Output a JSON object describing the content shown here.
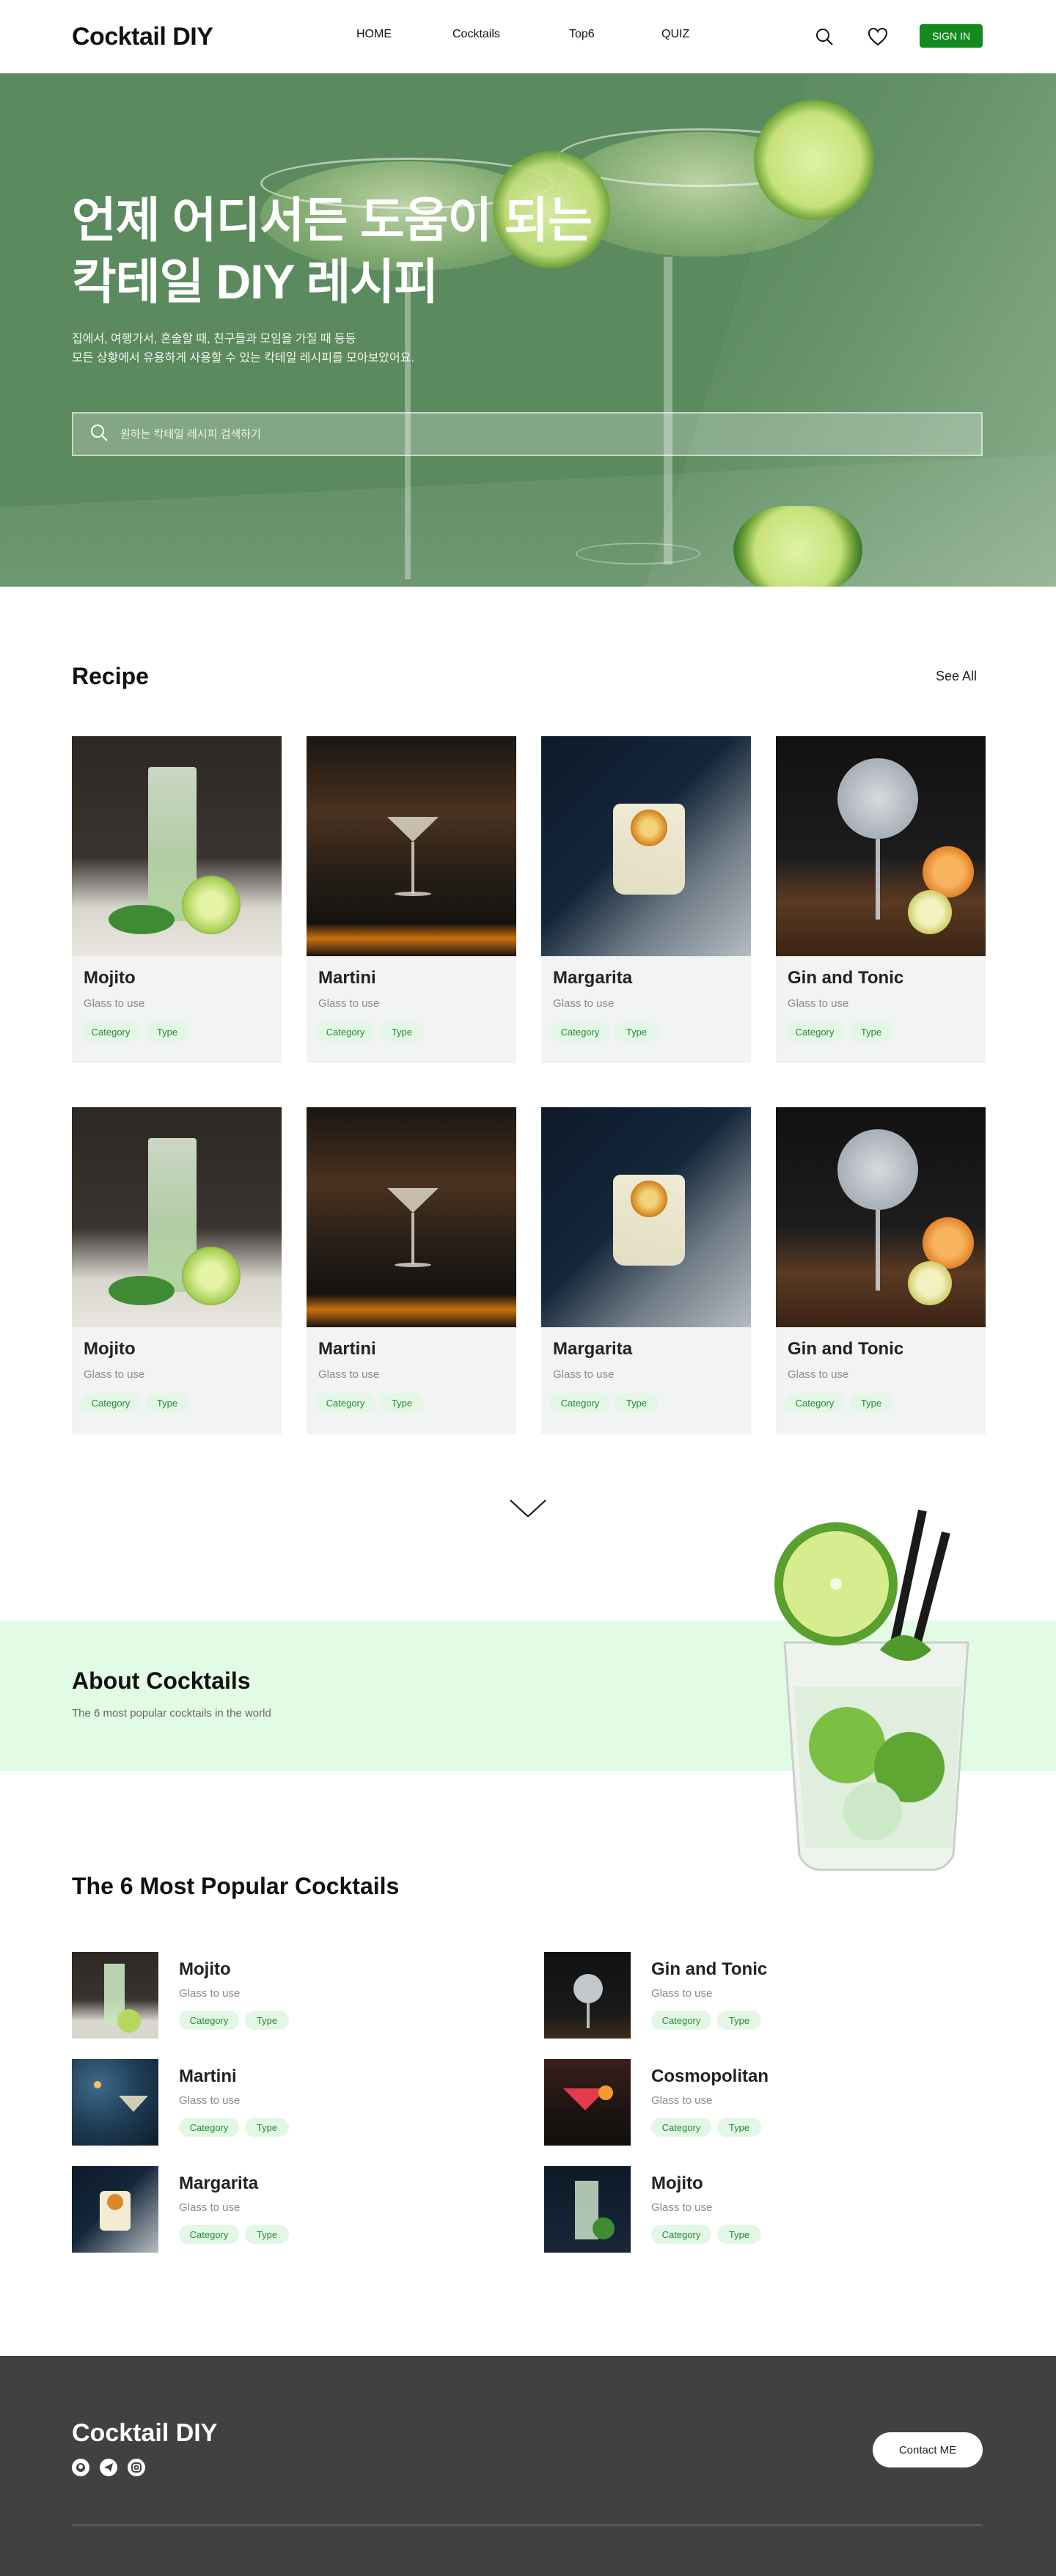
{
  "header": {
    "logo": "Cocktail DIY",
    "nav": [
      "HOME",
      "Cocktails",
      "Top6",
      "QUIZ"
    ],
    "sign_in": "SIGN IN"
  },
  "hero": {
    "title_line1": "언제 어디서든 도움이 되는",
    "title_line2": "칵테일 DIY 레시피",
    "sub_line1": "집에서, 여행가서, 혼술할 때, 친구들과 모임을 가질 때 등등",
    "sub_line2": "모든 상황에서 유용하게 사용할 수 있는 칵테일 레시피를 모아보았어요.",
    "search_placeholder": "원하는 칵테일 레시피 검색하기"
  },
  "recipe": {
    "title": "Recipe",
    "see_all": "See All",
    "cards": [
      {
        "name": "Mojito",
        "glass": "Glass to use",
        "tag1": "Category",
        "tag2": "Type"
      },
      {
        "name": "Martini",
        "glass": "Glass to use",
        "tag1": "Category",
        "tag2": "Type"
      },
      {
        "name": "Margarita",
        "glass": "Glass to use",
        "tag1": "Category",
        "tag2": "Type"
      },
      {
        "name": "Gin and Tonic",
        "glass": "Glass to use",
        "tag1": "Category",
        "tag2": "Type"
      },
      {
        "name": "Mojito",
        "glass": "Glass to use",
        "tag1": "Category",
        "tag2": "Type"
      },
      {
        "name": "Martini",
        "glass": "Glass to use",
        "tag1": "Category",
        "tag2": "Type"
      },
      {
        "name": "Margarita",
        "glass": "Glass to use",
        "tag1": "Category",
        "tag2": "Type"
      },
      {
        "name": "Gin and Tonic",
        "glass": "Glass to use",
        "tag1": "Category",
        "tag2": "Type"
      }
    ]
  },
  "about": {
    "title": "About Cocktails",
    "subtitle": "The 6 most popular cocktails in the world"
  },
  "popular": {
    "title": "The 6 Most Popular Cocktails",
    "items": [
      {
        "name": "Mojito",
        "glass": "Glass to use",
        "tag1": "Category",
        "tag2": "Type"
      },
      {
        "name": "Martini",
        "glass": "Glass to use",
        "tag1": "Category",
        "tag2": "Type"
      },
      {
        "name": "Margarita",
        "glass": "Glass to use",
        "tag1": "Category",
        "tag2": "Type"
      },
      {
        "name": "Gin and Tonic",
        "glass": "Glass to use",
        "tag1": "Category",
        "tag2": "Type"
      },
      {
        "name": "Cosmopolitan",
        "glass": "Glass to use",
        "tag1": "Category",
        "tag2": "Type"
      },
      {
        "name": "Mojito",
        "glass": "Glass to use",
        "tag1": "Category",
        "tag2": "Type"
      }
    ]
  },
  "footer": {
    "logo": "Cocktail DIY",
    "contact": "Contact ME"
  },
  "colors": {
    "accent": "#138a1e",
    "hero_green": "#5a8a5d",
    "tag_bg": "#e4f6e6",
    "about_band": "#e2fbe5",
    "footer_bg": "#414141"
  },
  "icons": [
    "search-icon",
    "heart-icon",
    "chevron-down-icon",
    "github-icon",
    "telegram-icon",
    "instagram-icon"
  ]
}
